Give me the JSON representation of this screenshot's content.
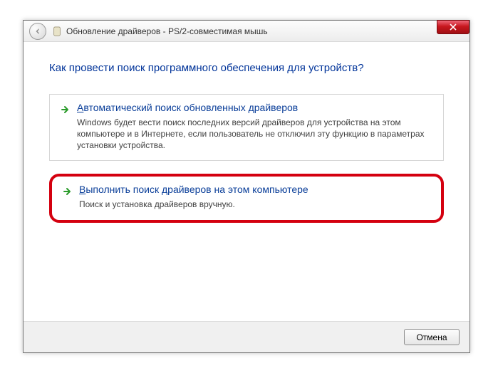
{
  "window": {
    "title": "Обновление драйверов - PS/2-совместимая мышь"
  },
  "heading": "Как провести поиск программного обеспечения для устройств?",
  "options": [
    {
      "accel": "А",
      "title_rest": "втоматический поиск обновленных драйверов",
      "description": "Windows будет вести поиск последних версий драйверов для устройства на этом компьютере и в Интернете, если пользователь не отключил эту функцию в параметрах установки устройства."
    },
    {
      "accel": "В",
      "title_rest": "ыполнить поиск драйверов на этом компьютере",
      "description": "Поиск и установка драйверов вручную."
    }
  ],
  "footer": {
    "cancel": "Отмена"
  }
}
